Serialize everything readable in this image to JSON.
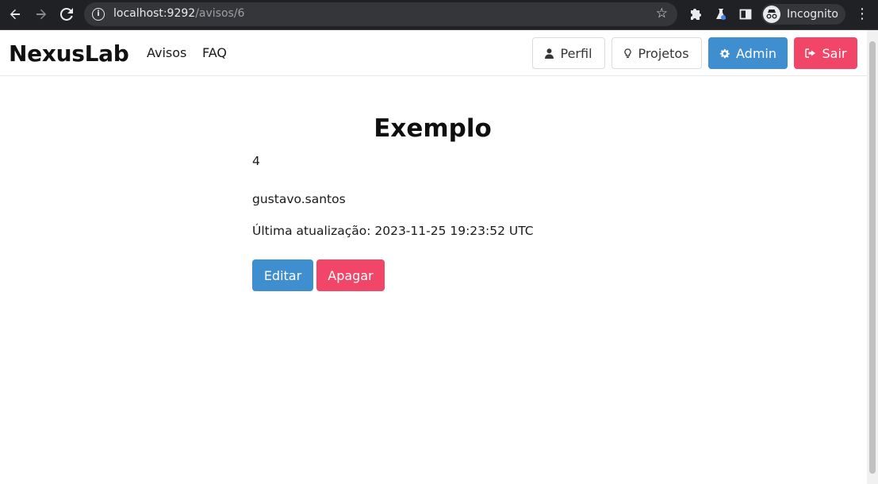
{
  "browser": {
    "url_host": "localhost:9292",
    "url_path": "/avisos/6",
    "profile_label": "Incognito",
    "icons": [
      "back-icon",
      "forward-icon",
      "reload-icon",
      "info-icon",
      "star-icon",
      "puzzle-icon",
      "flask-icon",
      "sidebar-icon",
      "incognito-icon",
      "more-icon"
    ]
  },
  "navbar": {
    "brand": "NexusLab",
    "links": [
      "Avisos",
      "FAQ"
    ],
    "buttons": {
      "perfil": "Perfil",
      "projetos": "Projetos",
      "admin": "Admin",
      "sair": "Sair"
    }
  },
  "aviso": {
    "title": "Exemplo",
    "body": "4",
    "author": "gustavo.santos",
    "updated": "Última atualização: 2023-11-25 19:23:52 UTC",
    "edit_label": "Editar",
    "delete_label": "Apagar"
  },
  "colors": {
    "info": "#3e8ed0",
    "danger": "#f14668",
    "chrome_bg": "#202124"
  }
}
